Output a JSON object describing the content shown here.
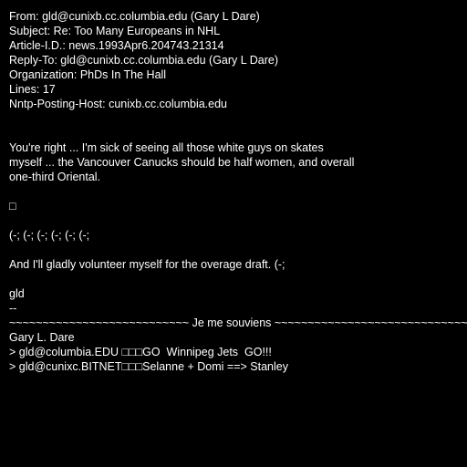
{
  "theme": {
    "background": "#000000",
    "text": "#ffffff"
  },
  "header": {
    "from": "From: gld@cunixb.cc.columbia.edu (Gary L Dare)",
    "subject": "Subject: Re: Too Many Europeans in NHL",
    "article_id": "Article-I.D.: news.1993Apr6.204743.21314",
    "reply_to": "Reply-To: gld@cunixb.cc.columbia.edu (Gary L Dare)",
    "organization": "Organization: PhDs In The Hall",
    "lines": "Lines: 17",
    "nntp_host": "Nntp-Posting-Host: cunixb.cc.columbia.edu"
  },
  "body": {
    "para1_line1": "You're right ... I'm sick of seeing all those white guys on skates",
    "para1_line2": "myself ... the Vancouver Canucks should be half women, and overall",
    "para1_line3": "one-third Oriental.",
    "box_char": "□",
    "smileys": "(-; (-; (-; (-; (-; (-;",
    "draft_line": "And I'll gladly volunteer myself for the overage draft. (-;",
    "signoff": "gld"
  },
  "signature": {
    "separator": "--",
    "banner": "~~~~~~~~~~~~~~~~~~~~~~~~~~~ Je me souviens ~~~~~~~~~~~~~~~~~~~~~~~~~~~~~~~~",
    "name": "Gary L. Dare",
    "line1": "> gld@columbia.EDU □□□GO  Winnipeg Jets  GO!!!",
    "line2": "> gld@cunixc.BITNET□□□Selanne + Domi ==> Stanley"
  }
}
